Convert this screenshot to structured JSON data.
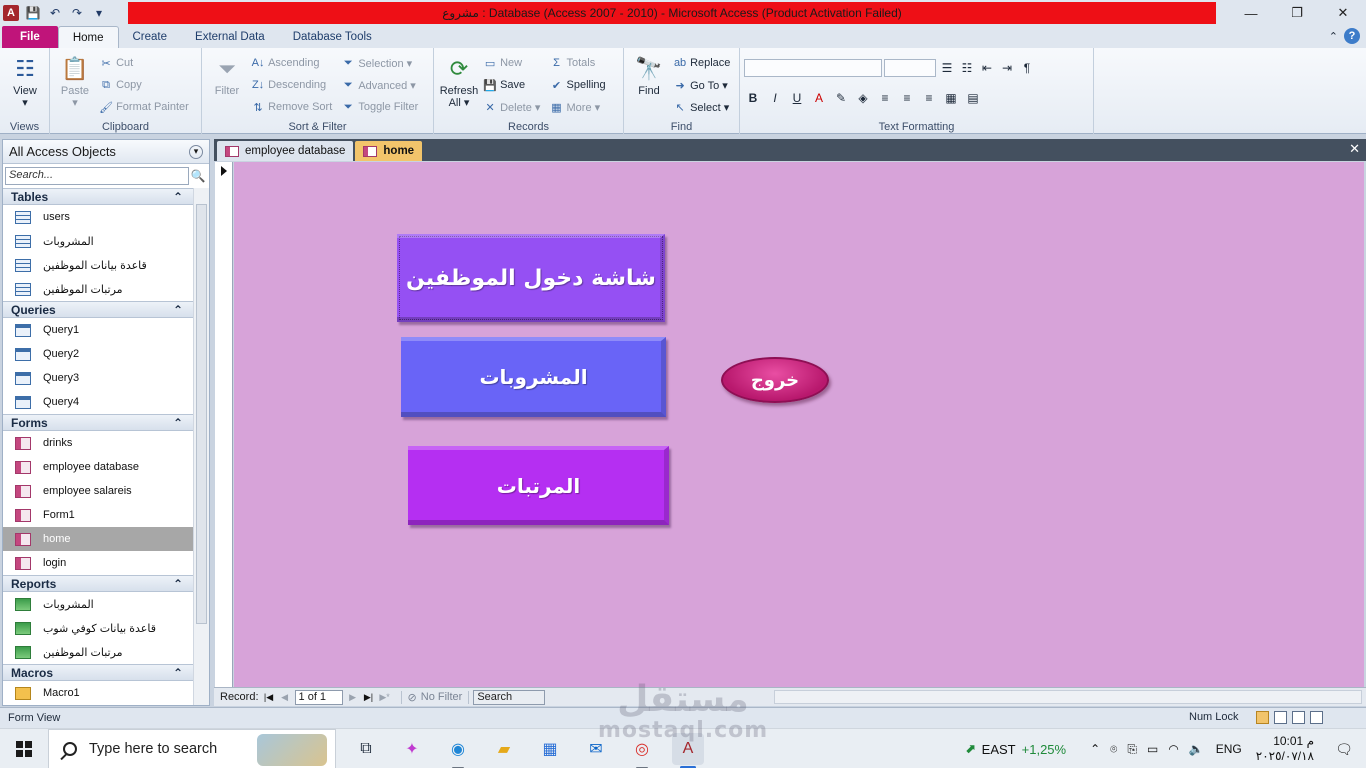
{
  "window": {
    "title": "مشروع : Database (Access 2007 - 2010)  -  Microsoft Access (Product Activation Failed)",
    "minimize": "—",
    "maximize": "❐",
    "close": "✕",
    "title_color": "#ee0f16"
  },
  "ribbon_tabs": [
    "File",
    "Home",
    "Create",
    "External Data",
    "Database Tools"
  ],
  "ribbon": {
    "views": {
      "view_label": "View",
      "group": "Views"
    },
    "clipboard": {
      "paste": "Paste",
      "cut": "Cut",
      "copy": "Copy",
      "format_painter": "Format Painter",
      "group": "Clipboard"
    },
    "sort_filter": {
      "filter": "Filter",
      "ascending": "Ascending",
      "descending": "Descending",
      "remove_sort": "Remove Sort",
      "selection": "Selection ▾",
      "advanced": "Advanced ▾",
      "toggle_filter": "Toggle Filter",
      "group": "Sort & Filter"
    },
    "records": {
      "refresh_all": "Refresh",
      "refresh_all_2": "All ▾",
      "new": "New",
      "save": "Save",
      "delete": "Delete ▾",
      "totals": "Totals",
      "spelling": "Spelling",
      "more": "More ▾",
      "group": "Records"
    },
    "find": {
      "find": "Find",
      "replace": "Replace",
      "go_to": "Go To ▾",
      "select": "Select ▾",
      "group": "Find"
    },
    "text_formatting": {
      "bold": "B",
      "italic": "I",
      "underline": "U",
      "group": "Text Formatting"
    }
  },
  "nav_pane": {
    "title": "All Access Objects",
    "search_placeholder": "Search...",
    "sections": [
      {
        "name": "Tables",
        "type": "table",
        "items": [
          "users",
          "المشروبات",
          "قاعدة بيانات الموظفين",
          "مرتبات الموظفين"
        ]
      },
      {
        "name": "Queries",
        "type": "query",
        "items": [
          "Query1",
          "Query2",
          "Query3",
          "Query4"
        ]
      },
      {
        "name": "Forms",
        "type": "form",
        "items": [
          "drinks",
          "employee database",
          "employee salareis",
          "Form1",
          "home",
          "login"
        ]
      },
      {
        "name": "Reports",
        "type": "report",
        "items": [
          "المشروبات",
          "قاعدة بيانات كوفي شوب",
          "مرتبات الموظفين"
        ]
      },
      {
        "name": "Macros",
        "type": "macro",
        "items": [
          "Macro1"
        ]
      }
    ],
    "selected_item": "home"
  },
  "doc_tabs": [
    {
      "label": "employee database",
      "active": false
    },
    {
      "label": "home",
      "active": true
    }
  ],
  "form": {
    "background": "#d7a3d9",
    "btn_employee_login": "شاشة دخول الموظفين",
    "btn_drinks": "المشروبات",
    "btn_salaries": "المرتبات",
    "btn_exit": "خروج"
  },
  "record_nav": {
    "label": "Record:",
    "current": "1 of 1",
    "filter": "No Filter",
    "search": "Search"
  },
  "status_bar": {
    "mode": "Form View",
    "num_lock": "Num Lock"
  },
  "taskbar": {
    "search_placeholder": "Type here to search",
    "stock_name": "EAST",
    "stock_change": "+1,25%",
    "language": "ENG",
    "time": "10:01 م",
    "date": "٢٠٢٥/٠٧/١٨"
  },
  "watermark": {
    "line1": "مستقل",
    "line2": "mostaql.com"
  }
}
